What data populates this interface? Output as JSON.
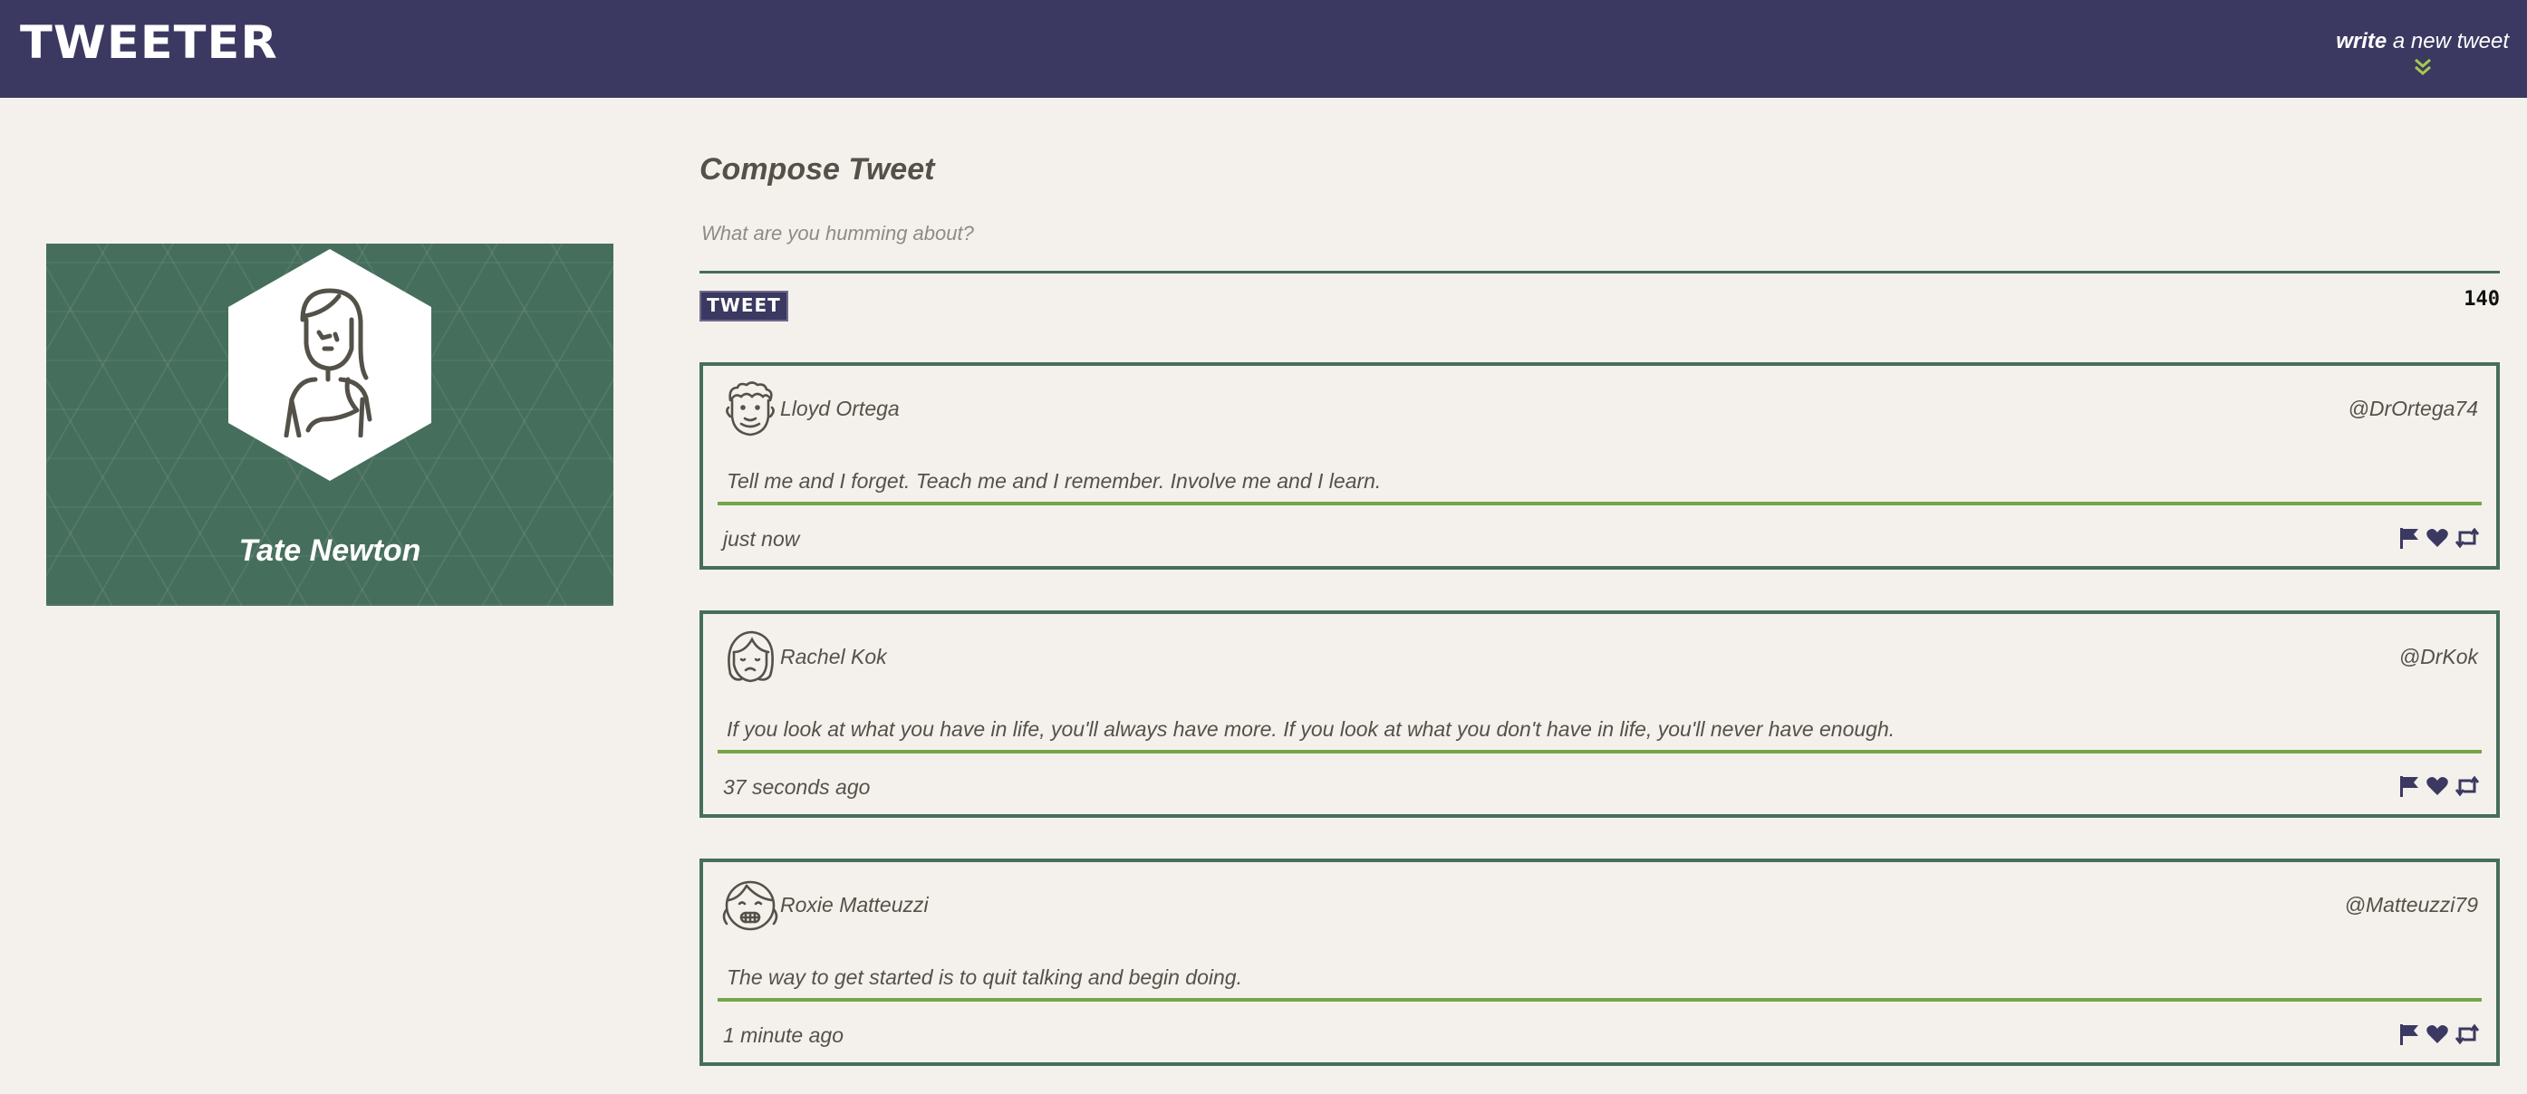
{
  "nav": {
    "brand": "TWEETER",
    "write_strong": "write",
    "write_rest": " a new tweet",
    "chevron_icon": "double-chevron-down-icon"
  },
  "profile": {
    "name": "Tate Newton",
    "avatar_icon": "user-avatar-icon"
  },
  "compose": {
    "title": "Compose Tweet",
    "placeholder": "What are you humming about?",
    "button_label": "TWEET",
    "counter": "140"
  },
  "tweets": [
    {
      "name": "Lloyd Ortega",
      "handle": "@DrOrtega74",
      "text": "Tell me and I forget. Teach me and I remember. Involve me and I learn.",
      "time": "just now"
    },
    {
      "name": "Rachel Kok",
      "handle": "@DrKok",
      "text": "If you look at what you have in life, you'll always have more. If you look at what you don't have in life, you'll never have enough.",
      "time": "37 seconds ago"
    },
    {
      "name": "Roxie Matteuzzi",
      "handle": "@Matteuzzi79",
      "text": "The way to get started is to quit talking and begin doing.",
      "time": "1 minute ago"
    }
  ],
  "actions": [
    "flag-icon",
    "heart-icon",
    "retweet-icon"
  ],
  "colors": {
    "nav_bg": "#3b3961",
    "page_bg": "#f4f1ec",
    "profile_bg": "#466e5c",
    "tweet_border": "#466e5c",
    "tweet_rule": "#75a548",
    "icon_color": "#3b3961",
    "chevron": "#a7c850"
  }
}
